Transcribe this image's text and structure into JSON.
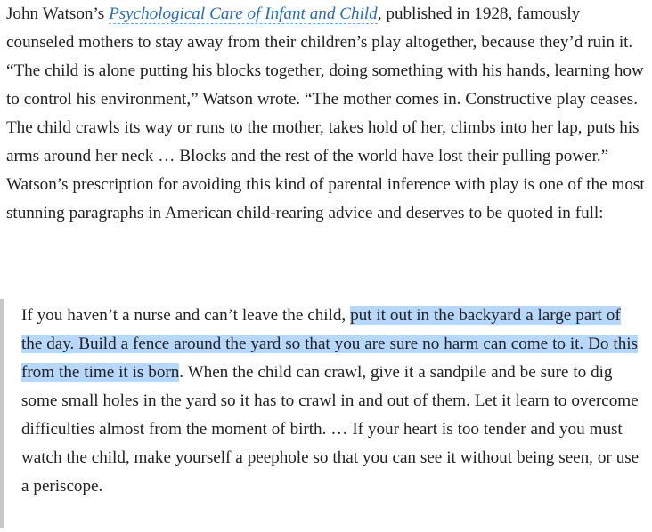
{
  "article": {
    "intro": {
      "before_link": "John Watson’s ",
      "link_text": "Psychological Care of Infant and Child",
      "after_link": ", published in 1928, famously counseled mothers to stay away from their children’s play altogether, because they’d ruin it. “The child is alone putting his blocks together, doing something with his hands, learning how to control his environment,” Watson wrote. “The mother comes in. Constructive play ceases. The child crawls its way or runs to the mother, takes hold of her, climbs into her lap, puts his arms around her neck … Blocks and the rest of the world have lost their pulling power.” Watson’s prescription for avoiding this kind of parental inference with play is one of the most stunning paragraphs in American child-rearing advice and deserves to be quoted in full:"
    },
    "blockquote": {
      "before_highlight": "If you haven’t a nurse and can’t leave the child, ",
      "highlighted": "put it out in the backyard a large part of the day. Build a fence around the yard so that you are sure no harm can come to it. Do this from the time it is born",
      "after_highlight": ". When the child can crawl, give it a sandpile and be sure to dig some small holes in the yard so it has to crawl in and out of them. Let it learn to overcome difficulties almost from the moment of birth. … If your heart is too tender and you must watch the child, make yourself a peephole so that you can see it without being seen, or use a periscope."
    }
  },
  "colors": {
    "text": "#222222",
    "link": "#2a6db5",
    "highlight": "#b7d7fb",
    "quote_bar": "#c8c8c8"
  }
}
